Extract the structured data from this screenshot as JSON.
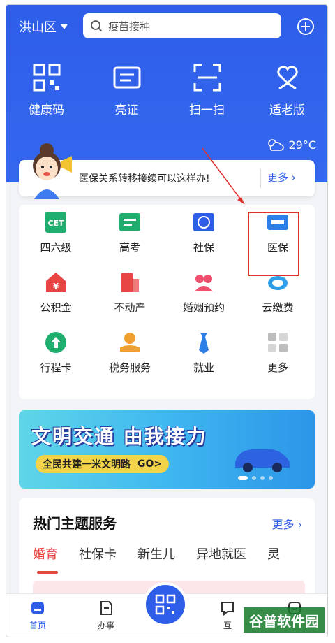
{
  "header": {
    "city": "洪山区",
    "search_placeholder": "疫苗接种"
  },
  "quick_actions": [
    {
      "label": "健康码",
      "icon": "qr-grid-icon"
    },
    {
      "label": "亮证",
      "icon": "id-card-icon"
    },
    {
      "label": "扫一扫",
      "icon": "scan-icon"
    },
    {
      "label": "适老版",
      "icon": "heart-person-icon"
    }
  ],
  "weather": {
    "temp": "29°C",
    "icon": "partly-cloudy-icon"
  },
  "notice": {
    "text": "医保关系转移接续可以这样办!",
    "more": "更多 ›"
  },
  "services": [
    {
      "label": "四六级",
      "icon": "cet-icon",
      "color": "#1fae6e"
    },
    {
      "label": "高考",
      "icon": "gaokao-icon",
      "color": "#1fae6e"
    },
    {
      "label": "社保",
      "icon": "social-security-icon",
      "color": "#2e5ee8"
    },
    {
      "label": "医保",
      "icon": "chs-medical-insurance-icon",
      "color": "#2e7ee8"
    },
    {
      "label": "公积金",
      "icon": "housing-fund-icon",
      "color": "#e84545"
    },
    {
      "label": "不动产",
      "icon": "real-estate-icon",
      "color": "#e84545"
    },
    {
      "label": "婚姻预约",
      "icon": "marriage-icon",
      "color": "#f0506e"
    },
    {
      "label": "云缴费",
      "icon": "cloud-pay-icon",
      "color": "#2e9ee8"
    },
    {
      "label": "行程卡",
      "icon": "trip-card-icon",
      "color": "#1fae6e"
    },
    {
      "label": "税务服务",
      "icon": "tax-service-icon",
      "color": "#f0a030"
    },
    {
      "label": "就业",
      "icon": "tie-employment-icon",
      "color": "#2e7ee8"
    },
    {
      "label": "更多",
      "icon": "more-grid-icon",
      "color": "#bdbdbd"
    }
  ],
  "banner": {
    "title": "文明交通 由我接力",
    "slogan": "全民共建一米文明路",
    "go": "GO>"
  },
  "topics": {
    "title": "热门主题服务",
    "more": "更多 ›",
    "tabs": [
      "婚育",
      "社保卡",
      "新生儿",
      "异地就医",
      "灵"
    ]
  },
  "tabbar": {
    "home": "首页",
    "affairs": "办事",
    "interact": "互"
  },
  "watermark": "谷普软件园",
  "colors": {
    "primary": "#2e5ee8",
    "highlight": "#e0302a",
    "tab_active": "#e84545"
  }
}
